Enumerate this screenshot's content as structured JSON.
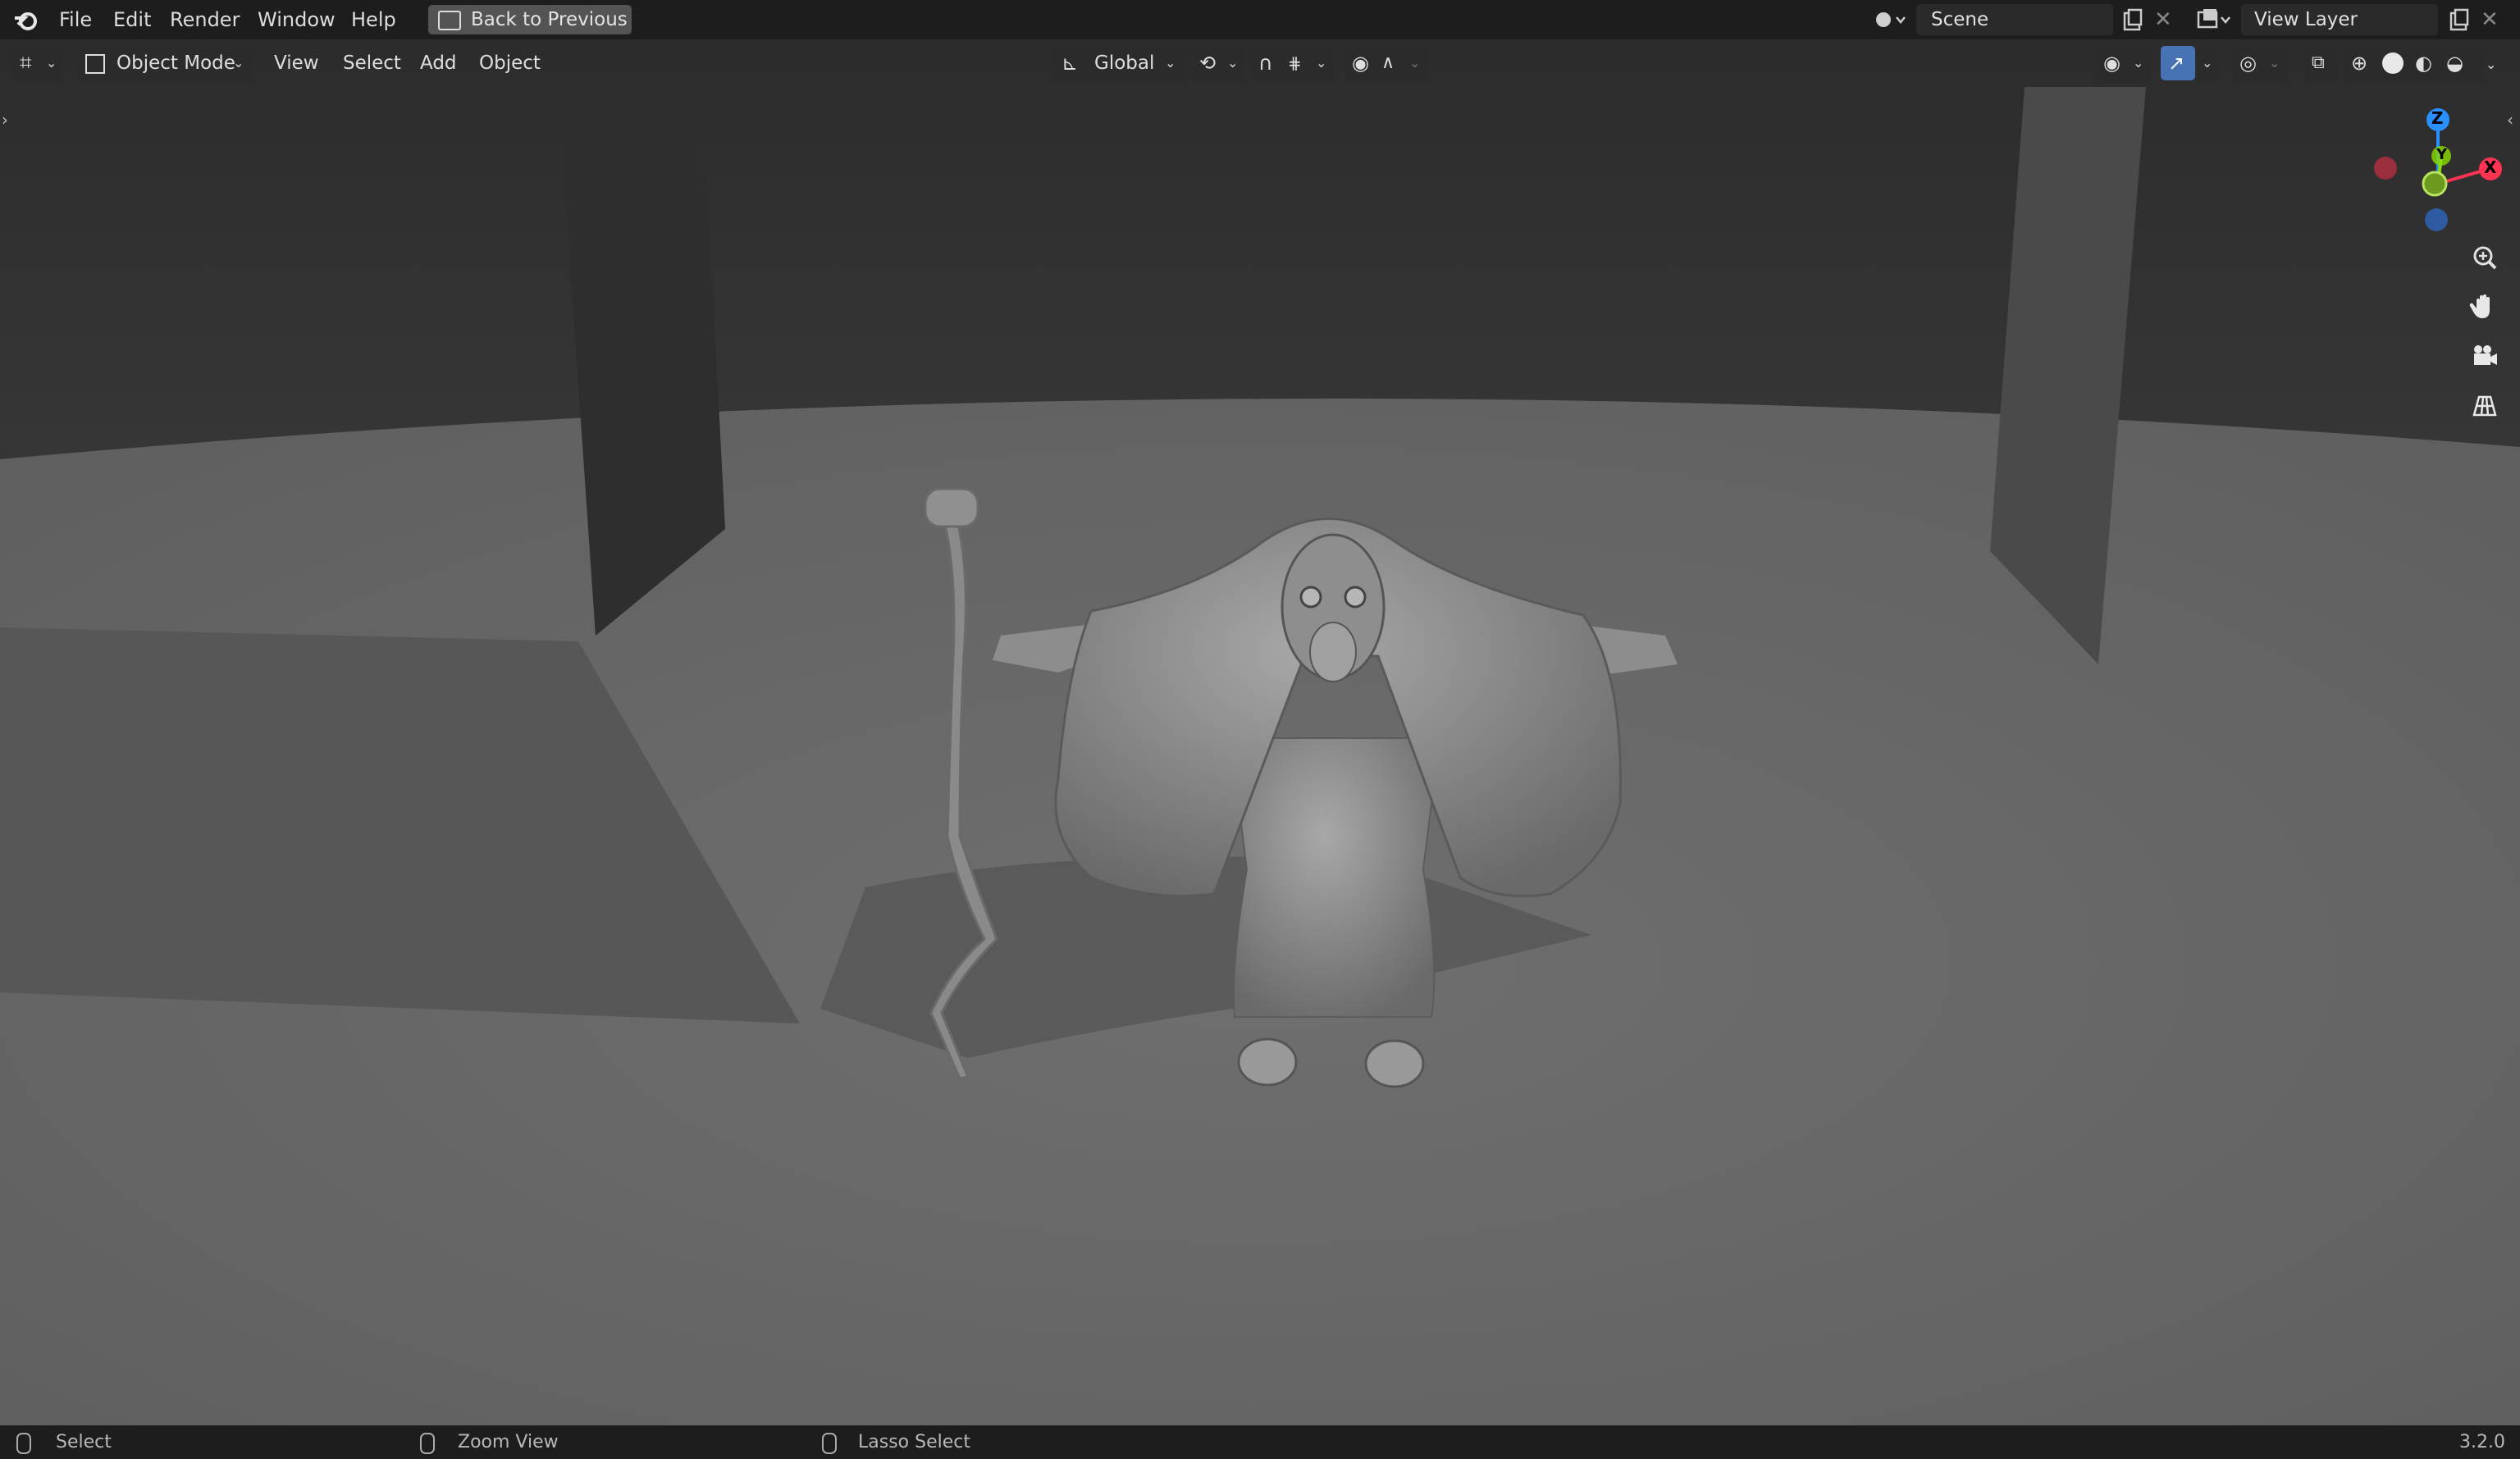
{
  "menu": {
    "file": "File",
    "edit": "Edit",
    "render": "Render",
    "window": "Window",
    "help": "Help",
    "back_to_previous": "Back to Previous"
  },
  "scene": {
    "name": "Scene"
  },
  "view_layer": {
    "name": "View Layer"
  },
  "viewport_header": {
    "mode": "Object Mode",
    "view": "View",
    "select": "Select",
    "add": "Add",
    "object": "Object",
    "transform_orientation": "Global"
  },
  "gizmo": {
    "z": "Z",
    "y": "Y",
    "x": "X"
  },
  "status": {
    "select": "Select",
    "zoom_view": "Zoom View",
    "lasso_select": "Lasso Select",
    "version": "3.2.0"
  },
  "colors": {
    "accent_blue": "#4772b3",
    "axis_x": "#ff3352",
    "axis_y": "#8bdc00",
    "axis_z": "#2890ff"
  }
}
